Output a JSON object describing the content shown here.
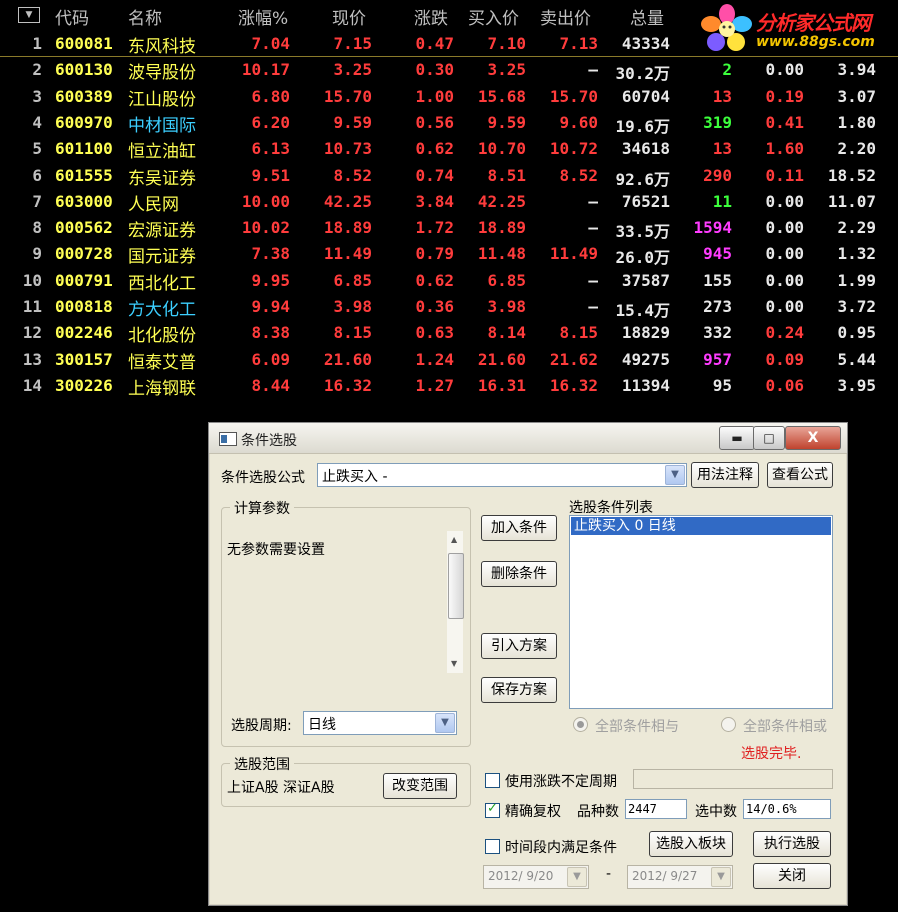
{
  "table": {
    "headers": [
      "代码",
      "名称",
      "涨幅%",
      "现价",
      "涨跌",
      "买入价",
      "卖出价",
      "总量"
    ],
    "sort_icon": "triangle-down-icon",
    "rows": [
      {
        "idx": "1",
        "code": "600081",
        "name": "东风科技",
        "name_color": "yellow",
        "pct": "7.04",
        "price": "7.15",
        "chg": "0.47",
        "buy": "7.10",
        "sell": "7.13",
        "vol": "43334",
        "c9": "",
        "c10": "",
        "c11": "",
        "c9_color": "",
        "c10_color": ""
      },
      {
        "idx": "2",
        "code": "600130",
        "name": "波导股份",
        "name_color": "yellow",
        "pct": "10.17",
        "price": "3.25",
        "chg": "0.30",
        "buy": "3.25",
        "sell": "—",
        "vol": "30.2万",
        "c9": "2",
        "c10": "0.00",
        "c11": "3.94",
        "c9_color": "green",
        "c10_color": "white"
      },
      {
        "idx": "3",
        "code": "600389",
        "name": "江山股份",
        "name_color": "yellow",
        "pct": "6.80",
        "price": "15.70",
        "chg": "1.00",
        "buy": "15.68",
        "sell": "15.70",
        "vol": "60704",
        "c9": "13",
        "c10": "0.19",
        "c11": "3.07",
        "c9_color": "red",
        "c10_color": "red"
      },
      {
        "idx": "4",
        "code": "600970",
        "name": "中材国际",
        "name_color": "cyan",
        "pct": "6.20",
        "price": "9.59",
        "chg": "0.56",
        "buy": "9.59",
        "sell": "9.60",
        "vol": "19.6万",
        "c9": "319",
        "c10": "0.41",
        "c11": "1.80",
        "c9_color": "green",
        "c10_color": "red"
      },
      {
        "idx": "5",
        "code": "601100",
        "name": "恒立油缸",
        "name_color": "yellow",
        "pct": "6.13",
        "price": "10.73",
        "chg": "0.62",
        "buy": "10.70",
        "sell": "10.72",
        "vol": "34618",
        "c9": "13",
        "c10": "1.60",
        "c11": "2.20",
        "c9_color": "red",
        "c10_color": "red"
      },
      {
        "idx": "6",
        "code": "601555",
        "name": "东吴证券",
        "name_color": "yellow",
        "pct": "9.51",
        "price": "8.52",
        "chg": "0.74",
        "buy": "8.51",
        "sell": "8.52",
        "vol": "92.6万",
        "c9": "290",
        "c10": "0.11",
        "c11": "18.52",
        "c9_color": "red",
        "c10_color": "red"
      },
      {
        "idx": "7",
        "code": "603000",
        "name": "人民网",
        "name_color": "yellow",
        "pct": "10.00",
        "price": "42.25",
        "chg": "3.84",
        "buy": "42.25",
        "sell": "—",
        "vol": "76521",
        "c9": "11",
        "c10": "0.00",
        "c11": "11.07",
        "c9_color": "green",
        "c10_color": "white"
      },
      {
        "idx": "8",
        "code": "000562",
        "name": "宏源证券",
        "name_color": "yellow",
        "pct": "10.02",
        "price": "18.89",
        "chg": "1.72",
        "buy": "18.89",
        "sell": "—",
        "vol": "33.5万",
        "c9": "1594",
        "c10": "0.00",
        "c11": "2.29",
        "c9_color": "magenta",
        "c10_color": "white"
      },
      {
        "idx": "9",
        "code": "000728",
        "name": "国元证券",
        "name_color": "yellow",
        "pct": "7.38",
        "price": "11.49",
        "chg": "0.79",
        "buy": "11.48",
        "sell": "11.49",
        "vol": "26.0万",
        "c9": "945",
        "c10": "0.00",
        "c11": "1.32",
        "c9_color": "magenta",
        "c10_color": "white"
      },
      {
        "idx": "10",
        "code": "000791",
        "name": "西北化工",
        "name_color": "yellow",
        "pct": "9.95",
        "price": "6.85",
        "chg": "0.62",
        "buy": "6.85",
        "sell": "—",
        "vol": "37587",
        "c9": "155",
        "c10": "0.00",
        "c11": "1.99",
        "c9_color": "white",
        "c10_color": "white"
      },
      {
        "idx": "11",
        "code": "000818",
        "name": "方大化工",
        "name_color": "cyan",
        "pct": "9.94",
        "price": "3.98",
        "chg": "0.36",
        "buy": "3.98",
        "sell": "—",
        "vol": "15.4万",
        "c9": "273",
        "c10": "0.00",
        "c11": "3.72",
        "c9_color": "white",
        "c10_color": "white"
      },
      {
        "idx": "12",
        "code": "002246",
        "name": "北化股份",
        "name_color": "yellow",
        "pct": "8.38",
        "price": "8.15",
        "chg": "0.63",
        "buy": "8.14",
        "sell": "8.15",
        "vol": "18829",
        "c9": "332",
        "c10": "0.24",
        "c11": "0.95",
        "c9_color": "white",
        "c10_color": "red"
      },
      {
        "idx": "13",
        "code": "300157",
        "name": "恒泰艾普",
        "name_color": "yellow",
        "pct": "6.09",
        "price": "21.60",
        "chg": "1.24",
        "buy": "21.60",
        "sell": "21.62",
        "vol": "49275",
        "c9": "957",
        "c10": "0.09",
        "c11": "5.44",
        "c9_color": "magenta",
        "c10_color": "red"
      },
      {
        "idx": "14",
        "code": "300226",
        "name": "上海钢联",
        "name_color": "yellow",
        "pct": "8.44",
        "price": "16.32",
        "chg": "1.27",
        "buy": "16.31",
        "sell": "16.32",
        "vol": "11394",
        "c9": "95",
        "c10": "0.06",
        "c11": "3.95",
        "c9_color": "white",
        "c10_color": "red"
      }
    ]
  },
  "colors": {
    "red": "#ff3c3c",
    "yellow": "#ffff54",
    "cyan": "#3ccfff",
    "green": "#3cff3c",
    "magenta": "#ff3cff",
    "white": "#e8e8e8",
    "selection": "#316ac5"
  },
  "watermark": {
    "title": "分析家公式网",
    "url": "www.88gs.com",
    "icon": "flower-logo-icon"
  },
  "dialog": {
    "title": "条件选股",
    "window_buttons": {
      "minimize": "▬",
      "maximize": "□",
      "close": "X"
    },
    "formula_label": "条件选股公式",
    "formula_value": "止跌买入 -",
    "usage_button": "用法注释",
    "view_button": "查看公式",
    "calc_group": "计算参数",
    "no_params": "无参数需要设置",
    "period_label": "选股周期:",
    "period_value": "日线",
    "add_button": "加入条件",
    "delete_button": "删除条件",
    "import_button": "引入方案",
    "save_button": "保存方案",
    "cond_list_label": "选股条件列表",
    "conditions": [
      "止跌买入  0  日线"
    ],
    "radio_and": "全部条件相与",
    "radio_or": "全部条件相或",
    "status": "选股完毕.",
    "range_group": "选股范围",
    "range_value": "上证A股 深证A股",
    "change_range_button": "改变范围",
    "use_unfixed_period": "使用涨跌不定周期",
    "precise_rights": "精确复权",
    "count_label": "品种数",
    "count_value": "2447",
    "selected_label": "选中数",
    "selected_value": "14/0.6%",
    "time_cond": "时间段内满足条件",
    "to_block_button": "选股入板块",
    "execute_button": "执行选股",
    "close_button": "关闭",
    "date_from": "2012/ 9/20",
    "date_sep": "-",
    "date_to": "2012/ 9/27"
  }
}
